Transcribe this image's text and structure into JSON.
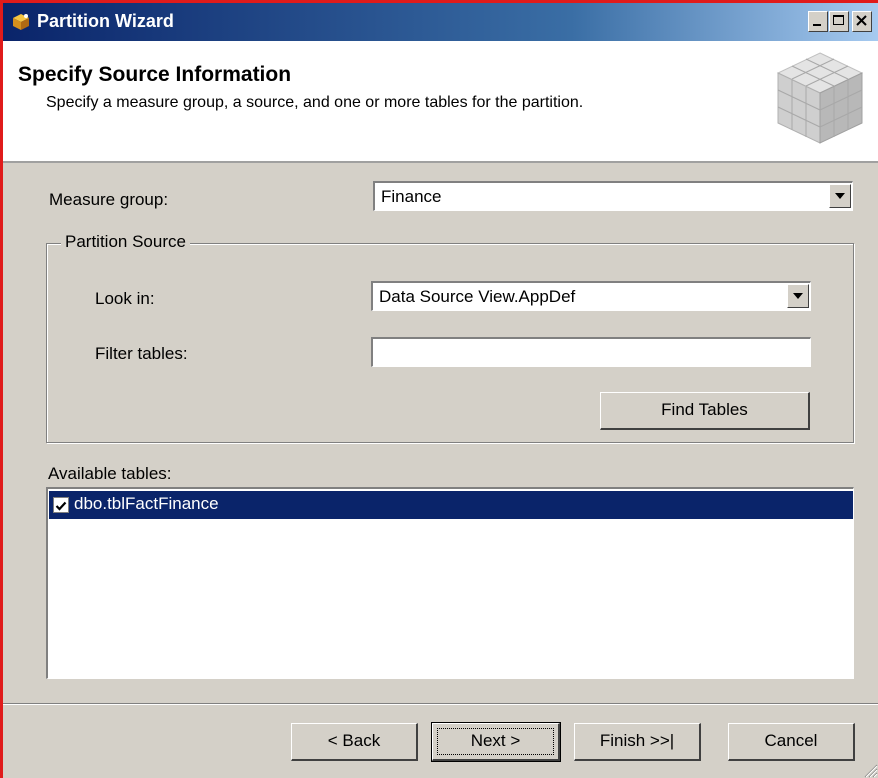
{
  "window": {
    "title": "Partition Wizard"
  },
  "header": {
    "title": "Specify Source Information",
    "subtitle": "Specify a measure group, a source, and one or more tables for the partition."
  },
  "measure_group": {
    "label": "Measure group:",
    "value": "Finance"
  },
  "partition_source": {
    "legend": "Partition Source",
    "look_in_label": "Look in:",
    "look_in_value": "Data Source View.AppDef",
    "filter_label": "Filter tables:",
    "filter_value": "",
    "find_button": "Find Tables"
  },
  "available_tables": {
    "label": "Available tables:",
    "items": [
      {
        "name": "dbo.tblFactFinance",
        "checked": true,
        "selected": true
      }
    ]
  },
  "buttons": {
    "back": "< Back",
    "next": "Next >",
    "finish": "Finish >>|",
    "cancel": "Cancel"
  },
  "colors": {
    "title_bar_start": "#0a246a",
    "title_bar_end": "#a6caf0",
    "dialog_face": "#d4d0c8",
    "selection": "#0a246a",
    "window_border": "#e01b1b"
  }
}
